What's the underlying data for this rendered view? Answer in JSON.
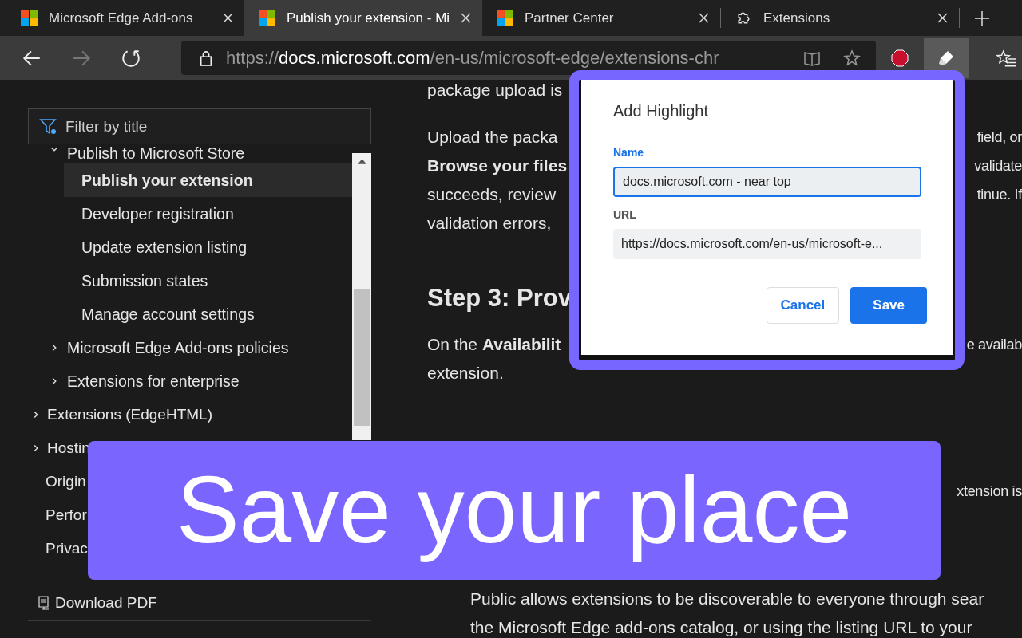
{
  "browser": {
    "tabs": [
      {
        "title": "Microsoft Edge Add-ons",
        "kind": "site",
        "selected": false
      },
      {
        "title": "Publish your extension - Mi",
        "kind": "site",
        "selected": true
      },
      {
        "title": "Partner Center",
        "kind": "site",
        "selected": false
      },
      {
        "title": "Extensions",
        "kind": "extensions",
        "selected": false
      }
    ],
    "nav": [
      {
        "kind": "back",
        "disabled": false
      },
      {
        "kind": "forward",
        "disabled": true
      },
      {
        "kind": "refresh",
        "disabled": false
      }
    ],
    "address": {
      "protocol": "https://",
      "host": "docs.microsoft.com",
      "path": "/en-us/microsoft-edge/extensions-chr"
    },
    "extensions": [
      {
        "kind": "adblock",
        "selected": false
      },
      {
        "kind": "highlighter",
        "selected": true
      }
    ]
  },
  "sidebar": {
    "filter": {
      "placeholder": "Filter by title"
    },
    "nested_items": [
      {
        "label": "Publish to Microsoft Store",
        "kind": "group",
        "expanded": true,
        "selected": false,
        "children": [
          {
            "label": "Publish your extension",
            "kind": "page",
            "selected": true
          },
          {
            "label": "Developer registration",
            "kind": "page",
            "selected": false
          },
          {
            "label": "Update extension listing",
            "kind": "page",
            "selected": false
          },
          {
            "label": "Submission states",
            "kind": "page",
            "selected": false
          },
          {
            "label": "Manage account settings",
            "kind": "page",
            "selected": false
          }
        ]
      },
      {
        "label": "Microsoft Edge Add-ons policies",
        "kind": "group",
        "expanded": false,
        "selected": false
      },
      {
        "label": "Extensions for enterprise",
        "kind": "group",
        "expanded": false,
        "selected": false
      }
    ],
    "items": [
      {
        "label": "Extensions (EdgeHTML)",
        "kind": "group",
        "expanded": false,
        "selected": false
      },
      {
        "label": "Hostin",
        "kind": "group",
        "expanded": false,
        "selected": false
      },
      {
        "label": "Origin",
        "kind": "page",
        "selected": false
      },
      {
        "label": "Perfor",
        "kind": "page",
        "selected": false
      },
      {
        "label": "Privac",
        "kind": "page",
        "selected": false
      }
    ],
    "download": "Download PDF"
  },
  "article": {
    "blocks": [
      {
        "kind": "para",
        "lines": [
          {
            "left": "package upload is",
            "bold": false
          }
        ]
      },
      {
        "kind": "para",
        "lines": [
          {
            "left": "Upload the packa",
            "right": "field, or",
            "bold": false
          },
          {
            "left": "Browse your files",
            "right": "validate",
            "bold": true
          },
          {
            "left": "succeeds, review",
            "right": "tinue. If",
            "bold": false
          },
          {
            "left": "validation errors,",
            "bold": false
          }
        ]
      },
      {
        "kind": "heading",
        "lines": [
          {
            "left": "Step 3: Prov",
            "bold": false
          }
        ]
      },
      {
        "kind": "para",
        "lines": [
          {
            "left": "On the **Availabilit**",
            "right": "e availab",
            "bold": false
          },
          {
            "left": "extension.",
            "bold": false
          }
        ]
      },
      {
        "kind": "para",
        "lines": [
          {
            "right": "xtension is",
            "bold": false
          }
        ]
      },
      {
        "kind": "indented",
        "lines": [
          {
            "left": "Public allows extensions to be discoverable to everyone through sear",
            "bold": false
          },
          {
            "left": "the Microsoft Edge add-ons catalog, or using the listing URL to your",
            "bold": false
          }
        ]
      }
    ]
  },
  "dialog": {
    "title": "Add Highlight",
    "name_label": "Name",
    "name_value": "docs.microsoft.com - near top",
    "url_label": "URL",
    "url_value": "https://docs.microsoft.com/en-us/microsoft-e...",
    "buttons": [
      {
        "label": "Cancel",
        "kind": "secondary"
      },
      {
        "label": "Save",
        "kind": "primary"
      }
    ]
  },
  "banner": {
    "text": "Save your place"
  }
}
